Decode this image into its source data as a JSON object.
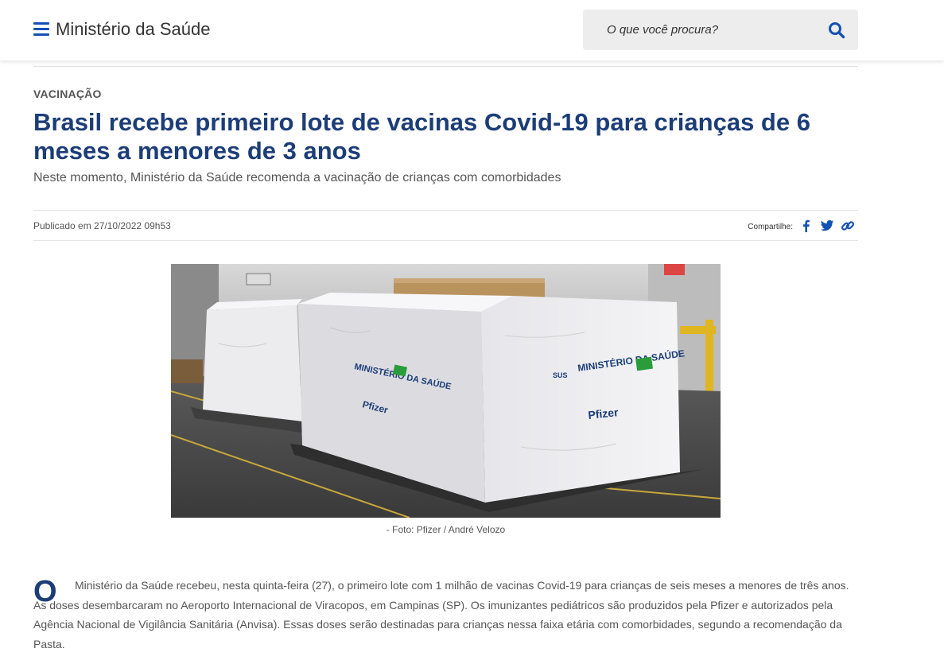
{
  "header": {
    "site_title": "Ministério da Saúde",
    "search_placeholder": "O que você procura?",
    "accent_color": "#1351b4"
  },
  "article": {
    "category": "VACINAÇÃO",
    "title": "Brasil recebe primeiro lote de vacinas Covid-19 para crianças de 6 meses a menores de 3 anos",
    "subtitle": "Neste momento, Ministério da Saúde recomenda a vacinação de crianças com comorbidades",
    "published": "Publicado em 27/10/2022 09h53",
    "share_label": "Compartilhe:",
    "share_icons": [
      "facebook-icon",
      "twitter-icon",
      "link-icon"
    ],
    "title_color": "#1c3d78",
    "image": {
      "box_labels": [
        "MINISTÉRIO DA SAÚDE",
        "SUS",
        "Pfizer"
      ]
    },
    "caption": "- Foto: Pfizer / André Velozo",
    "drop_cap": "O",
    "body": "Ministério da Saúde recebeu, nesta quinta-feira (27), o primeiro lote com 1 milhão de vacinas Covid-19 para crianças de seis meses a menores de três anos. As doses desembarcaram no Aeroporto Internacional de Viracopos, em Campinas (SP). Os imunizantes pediátricos são produzidos pela Pfizer e autorizados pela Agência Nacional de Vigilância Sanitária (Anvisa). Essas doses serão destinadas para crianças nessa faixa etária com comorbidades, segundo a recomendação da Pasta."
  }
}
